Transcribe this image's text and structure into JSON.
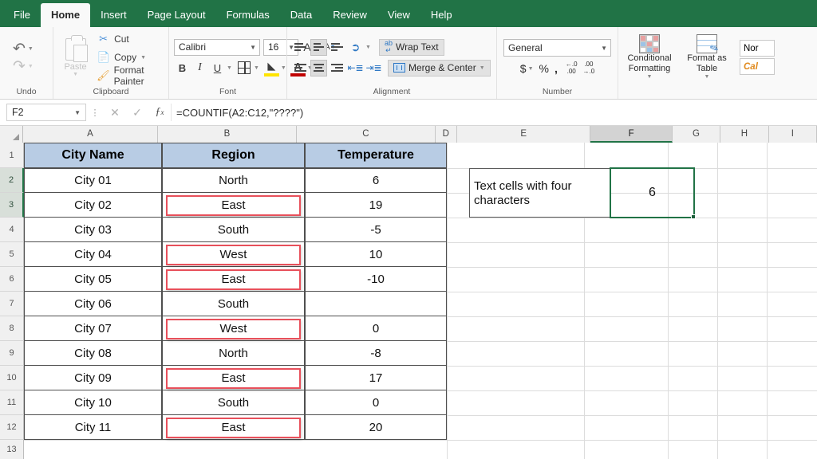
{
  "ribbon": {
    "tabs": [
      {
        "label": "File",
        "active": false
      },
      {
        "label": "Home",
        "active": true
      },
      {
        "label": "Insert",
        "active": false
      },
      {
        "label": "Page Layout",
        "active": false
      },
      {
        "label": "Formulas",
        "active": false
      },
      {
        "label": "Data",
        "active": false
      },
      {
        "label": "Review",
        "active": false
      },
      {
        "label": "View",
        "active": false
      },
      {
        "label": "Help",
        "active": false
      }
    ],
    "groups": {
      "undo": {
        "label": "Undo",
        "undo_icon": "undo-arrow-icon",
        "redo_icon": "redo-arrow-icon"
      },
      "clipboard": {
        "label": "Clipboard",
        "paste_label": "Paste",
        "cut_label": "Cut",
        "copy_label": "Copy",
        "format_painter_label": "Format Painter"
      },
      "font": {
        "label": "Font",
        "font_name": "Calibri",
        "font_size": "16",
        "bold": "B",
        "italic": "I",
        "underline": "U"
      },
      "alignment": {
        "label": "Alignment",
        "wrap_text_label": "Wrap Text",
        "merge_center_label": "Merge & Center"
      },
      "number": {
        "label": "Number",
        "format": "General",
        "currency": "$",
        "percent": "%",
        "comma": ",",
        "inc_dec": "increase-decimal-icon",
        "dec_dec": "decrease-decimal-icon"
      },
      "styles": {
        "conditional_formatting_label": "Conditional Formatting",
        "format_as_table_label": "Format as Table",
        "chip_normal": "Nor",
        "chip_calculation": "Cal"
      }
    }
  },
  "formula_bar": {
    "name_box": "F2",
    "cancel_icon": "cancel-x-icon",
    "enter_icon": "confirm-check-icon",
    "function_icon": "insert-function-icon",
    "formula": "=COUNTIF(A2:C12,\"????\")"
  },
  "grid": {
    "columns": [
      "A",
      "B",
      "C",
      "D",
      "E",
      "F",
      "G",
      "H",
      "I"
    ],
    "selected_column": "F",
    "rows": [
      "1",
      "2",
      "3",
      "4",
      "5",
      "6",
      "7",
      "8",
      "9",
      "10",
      "11",
      "12",
      "13"
    ],
    "highlighted_rows": [
      "2",
      "3"
    ],
    "headers": [
      "City Name",
      "Region",
      "Temperature"
    ],
    "data": [
      {
        "row": "2",
        "city": "City 01",
        "region": "North",
        "temp": "6",
        "marked": false
      },
      {
        "row": "3",
        "city": "City 02",
        "region": "East",
        "temp": "19",
        "marked": true
      },
      {
        "row": "4",
        "city": "City 03",
        "region": "South",
        "temp": "-5",
        "marked": false
      },
      {
        "row": "5",
        "city": "City 04",
        "region": "West",
        "temp": "10",
        "marked": true
      },
      {
        "row": "6",
        "city": "City 05",
        "region": "East",
        "temp": "-10",
        "marked": true
      },
      {
        "row": "7",
        "city": "City 06",
        "region": "South",
        "temp": "",
        "marked": false
      },
      {
        "row": "8",
        "city": "City 07",
        "region": "West",
        "temp": "0",
        "marked": true
      },
      {
        "row": "9",
        "city": "City 08",
        "region": "North",
        "temp": "-8",
        "marked": false
      },
      {
        "row": "10",
        "city": "City 09",
        "region": "East",
        "temp": "17",
        "marked": true
      },
      {
        "row": "11",
        "city": "City 10",
        "region": "South",
        "temp": "0",
        "marked": false
      },
      {
        "row": "12",
        "city": "City 11",
        "region": "East",
        "temp": "20",
        "marked": true
      }
    ],
    "annotation": {
      "label": "Text cells with four characters",
      "result": "6"
    }
  },
  "colors": {
    "brand_green": "#217346",
    "header_fill": "#b8cce4",
    "highlight_red": "#e8505b",
    "selection_green": "#217346"
  }
}
